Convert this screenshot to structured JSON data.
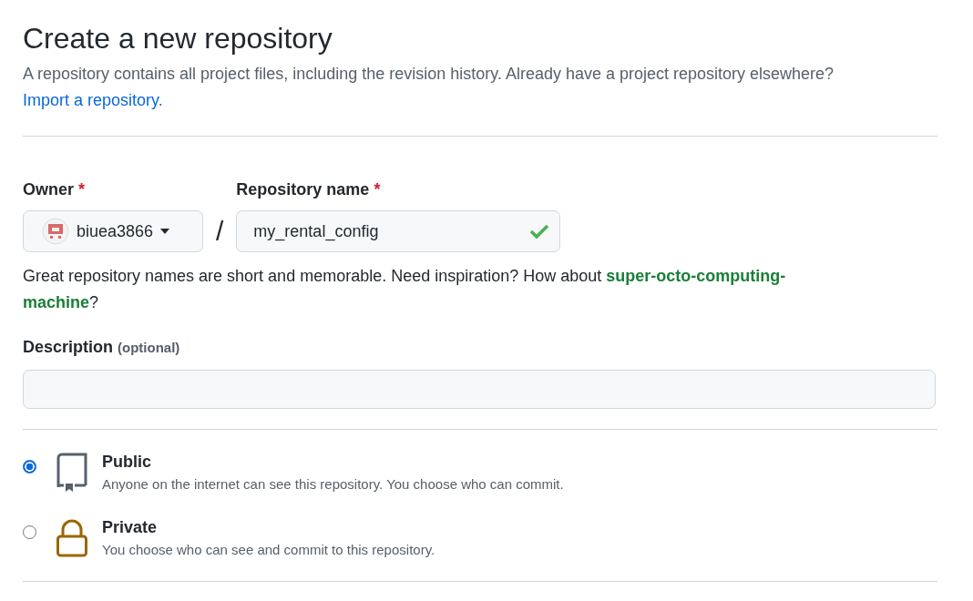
{
  "header": {
    "title": "Create a new repository",
    "description": "A repository contains all project files, including the revision history. Already have a project repository elsewhere?",
    "import_link": "Import a repository."
  },
  "owner": {
    "label": "Owner",
    "required_mark": "*",
    "value": "biuea3866"
  },
  "separator": "/",
  "repository_name": {
    "label": "Repository name",
    "required_mark": "*",
    "value": "my_rental_config",
    "valid": true
  },
  "name_hint": "Great repository names are short and memorable. Need inspiration? How about **super-octo-computing-machine**?",
  "description_field": {
    "label": "Description",
    "optional_note": "(optional)"
  },
  "visibility": [
    {
      "kind": "public",
      "label": "Public",
      "description": "Anyone on the internet can see this repository. You choose who can commit.",
      "selected": true
    },
    {
      "kind": "private",
      "label": "Private",
      "description": "You choose who can see and commit to this repository.",
      "selected": false
    }
  ]
}
